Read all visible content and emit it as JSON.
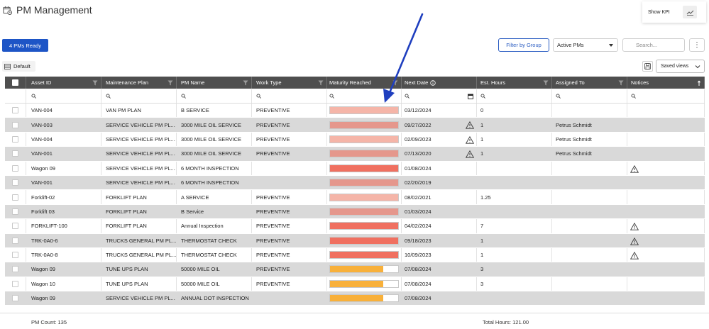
{
  "header": {
    "title": "PM Management",
    "show_kpi_label": "Show KPI"
  },
  "toolbar": {
    "ready_button_label": "4 PMs Ready",
    "filter_by_group_label": "Filter by Group",
    "active_select_value": "Active PMs",
    "search_placeholder": "Search...",
    "more_label": "⋮",
    "default_view_label": "Default",
    "saved_views_label": "Saved views"
  },
  "table": {
    "columns": [
      "Asset ID",
      "Maintenance Plan",
      "PM Name",
      "Work Type",
      "Maturity Reached",
      "Next Date",
      "Est. Hours",
      "Assigned To",
      "Notices"
    ],
    "colors": {
      "light": "#f5b5a8",
      "medium": "#e5978c",
      "strong": "#f07060",
      "warning": "#f8b03a"
    },
    "rows": [
      {
        "asset": "VAN-004",
        "plan": "VAN PM PLAN",
        "pm": "B SERVICE",
        "work": "PREVENTIVE",
        "maturity": 1.0,
        "maturity_color": "light",
        "next_date": "03/12/2024",
        "date_warning": false,
        "hours": "0",
        "assigned": "",
        "notice": false
      },
      {
        "asset": "VAN-003",
        "plan": "SERVICE VEHICLE PM PL...",
        "pm": "3000 MILE OIL SERVICE",
        "work": "PREVENTIVE",
        "maturity": 1.0,
        "maturity_color": "medium",
        "next_date": "09/27/2022",
        "date_warning": true,
        "hours": "1",
        "assigned": "Petrus Schmidt",
        "notice": false
      },
      {
        "asset": "VAN-004",
        "plan": "SERVICE VEHICLE PM PL...",
        "pm": "3000 MILE OIL SERVICE",
        "work": "PREVENTIVE",
        "maturity": 1.0,
        "maturity_color": "light",
        "next_date": "02/09/2023",
        "date_warning": true,
        "hours": "1",
        "assigned": "Petrus Schmidt",
        "notice": false
      },
      {
        "asset": "VAN-001",
        "plan": "SERVICE VEHICLE PM PL...",
        "pm": "3000 MILE OIL SERVICE",
        "work": "PREVENTIVE",
        "maturity": 1.0,
        "maturity_color": "medium",
        "next_date": "07/13/2020",
        "date_warning": true,
        "hours": "1",
        "assigned": "Petrus Schmidt",
        "notice": false
      },
      {
        "asset": "Wagon 09",
        "plan": "SERVICE VEHICLE PM PL...",
        "pm": "6 MONTH INSPECTION",
        "work": "",
        "maturity": 1.0,
        "maturity_color": "strong",
        "next_date": "01/08/2024",
        "date_warning": false,
        "hours": "",
        "assigned": "",
        "notice": true
      },
      {
        "asset": "VAN-001",
        "plan": "SERVICE VEHICLE PM PL...",
        "pm": "6 MONTH INSPECTION",
        "work": "",
        "maturity": 1.0,
        "maturity_color": "medium",
        "next_date": "02/20/2019",
        "date_warning": false,
        "hours": "",
        "assigned": "",
        "notice": false
      },
      {
        "asset": "Forklift-02",
        "plan": "FORKLIFT PLAN",
        "pm": "A SERVICE",
        "work": "PREVENTIVE",
        "maturity": 1.0,
        "maturity_color": "light",
        "next_date": "08/02/2021",
        "date_warning": false,
        "hours": "1.25",
        "assigned": "",
        "notice": false
      },
      {
        "asset": "Forklift 03",
        "plan": "FORKLIFT PLAN",
        "pm": "B Service",
        "work": "PREVENTIVE",
        "maturity": 1.0,
        "maturity_color": "medium",
        "next_date": "01/03/2024",
        "date_warning": false,
        "hours": "",
        "assigned": "",
        "notice": false
      },
      {
        "asset": "FORKLIFT-100",
        "plan": "FORKLIFT PLAN",
        "pm": "Annual Inspection",
        "work": "PREVENTIVE",
        "maturity": 1.0,
        "maturity_color": "strong",
        "next_date": "04/02/2024",
        "date_warning": false,
        "hours": "7",
        "assigned": "",
        "notice": true
      },
      {
        "asset": "TRK-0A0-6",
        "plan": "TRUCKS GENERAL PM PL...",
        "pm": "THERMOSTAT CHECK",
        "work": "PREVENTIVE",
        "maturity": 1.0,
        "maturity_color": "strong",
        "next_date": "09/18/2023",
        "date_warning": false,
        "hours": "1",
        "assigned": "",
        "notice": true
      },
      {
        "asset": "TRK-0A0-8",
        "plan": "TRUCKS GENERAL PM PL...",
        "pm": "THERMOSTAT CHECK",
        "work": "PREVENTIVE",
        "maturity": 1.0,
        "maturity_color": "strong",
        "next_date": "10/09/2023",
        "date_warning": false,
        "hours": "1",
        "assigned": "",
        "notice": true
      },
      {
        "asset": "Wagon 09",
        "plan": "TUNE UPS PLAN",
        "pm": "50000 MILE OIL",
        "work": "PREVENTIVE",
        "maturity": 0.78,
        "maturity_color": "warning",
        "next_date": "07/08/2024",
        "date_warning": false,
        "hours": "3",
        "assigned": "",
        "notice": false
      },
      {
        "asset": "Wagon 10",
        "plan": "TUNE UPS PLAN",
        "pm": "50000 MILE OIL",
        "work": "PREVENTIVE",
        "maturity": 0.78,
        "maturity_color": "warning",
        "next_date": "07/08/2024",
        "date_warning": false,
        "hours": "3",
        "assigned": "",
        "notice": false
      },
      {
        "asset": "Wagon 09",
        "plan": "SERVICE VEHICLE PM PL...",
        "pm": "ANNUAL DOT INSPECTION",
        "work": "",
        "maturity": 0.78,
        "maturity_color": "warning",
        "next_date": "07/08/2024",
        "date_warning": false,
        "hours": "",
        "assigned": "",
        "notice": false
      }
    ]
  },
  "footer": {
    "pm_count_label": "PM Count: 135",
    "total_hours_label": "Total Hours: 121.00"
  }
}
